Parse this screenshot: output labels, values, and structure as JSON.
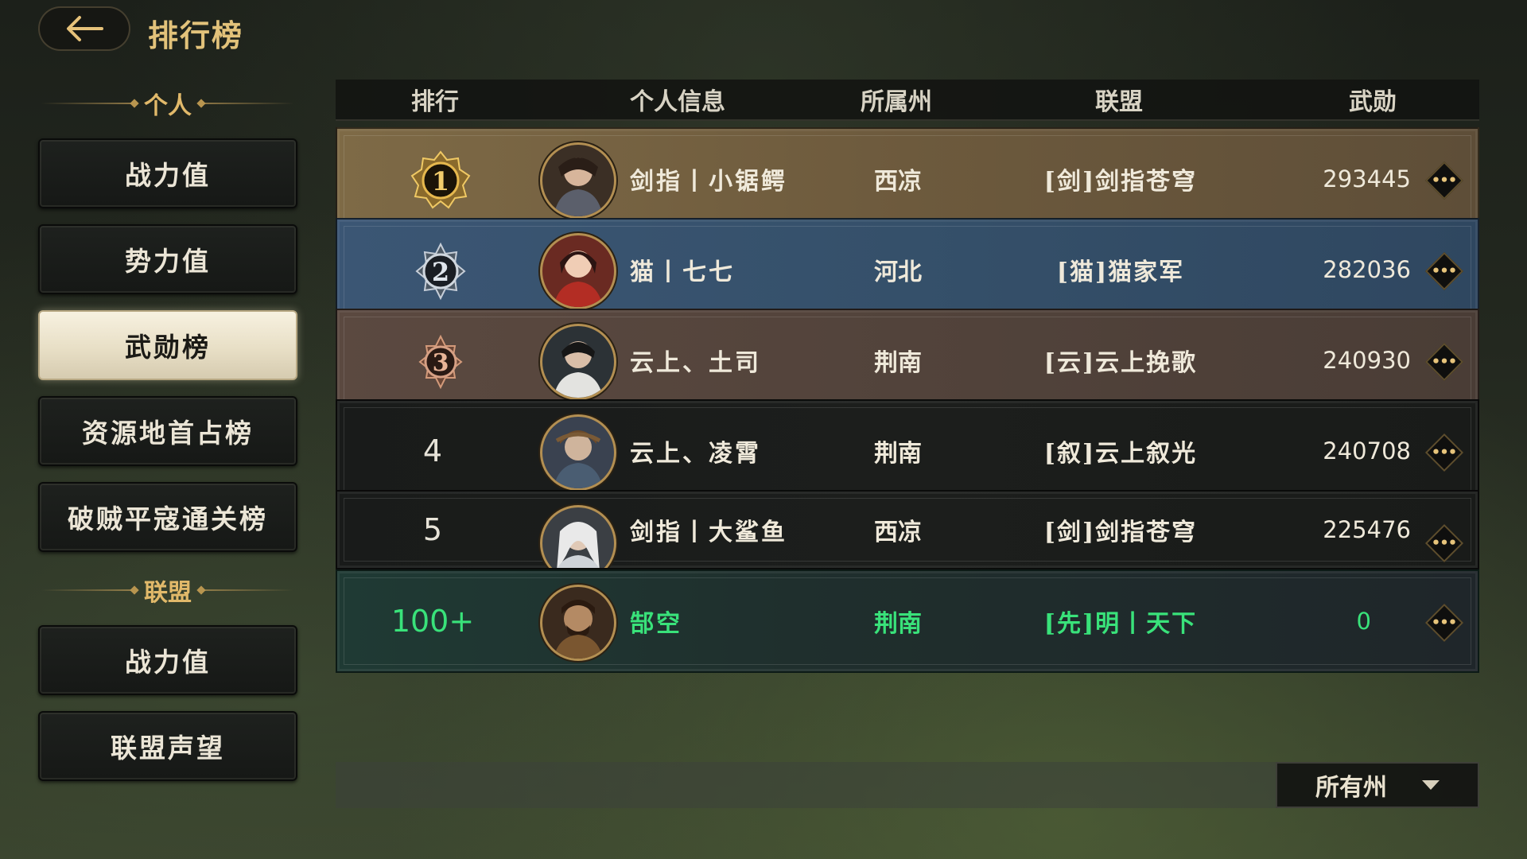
{
  "header": {
    "title": "排行榜",
    "back_icon": "arrow-left-icon"
  },
  "sidebar": {
    "personal_section": "个人",
    "personal_items": [
      {
        "label": "战力值",
        "active": false
      },
      {
        "label": "势力值",
        "active": false
      },
      {
        "label": "武勋榜",
        "active": true
      },
      {
        "label": "资源地首占榜",
        "active": false
      },
      {
        "label": "破贼平寇通关榜",
        "active": false
      }
    ],
    "alliance_section": "联盟",
    "alliance_items": [
      {
        "label": "战力值"
      },
      {
        "label": "联盟声望"
      }
    ]
  },
  "table": {
    "columns": [
      "排行",
      "个人信息",
      "所属州",
      "联盟",
      "武勋"
    ],
    "rows": [
      {
        "rank": "1",
        "name": "剑指丨小锯鳄",
        "state": "西凉",
        "alliance": "[剑]剑指苍穹",
        "score": "293445",
        "style": "gold"
      },
      {
        "rank": "2",
        "name": "猫丨七七",
        "state": "河北",
        "alliance": "[猫]猫家军",
        "score": "282036",
        "style": "blue"
      },
      {
        "rank": "3",
        "name": "云上、土司",
        "state": "荆南",
        "alliance": "[云]云上挽歌",
        "score": "240930",
        "style": "bronze"
      },
      {
        "rank": "4",
        "name": "云上、凌霄",
        "state": "荆南",
        "alliance": "[叙]云上叙光",
        "score": "240708",
        "style": "dark"
      },
      {
        "rank": "5",
        "name": "剑指丨大鲨鱼",
        "state": "西凉",
        "alliance": "[剑]剑指苍穹",
        "score": "225476",
        "style": "dark"
      }
    ],
    "self_row": {
      "rank": "100+",
      "name": "郜空",
      "state": "荆南",
      "alliance": "[先]明丨天下",
      "score": "0"
    },
    "more_icon": "more-dots-icon"
  },
  "filter": {
    "selected": "所有州",
    "caret_icon": "chevron-down-icon"
  },
  "colors": {
    "accent_gold": "#e2c27a",
    "self_green": "#39e27a"
  }
}
